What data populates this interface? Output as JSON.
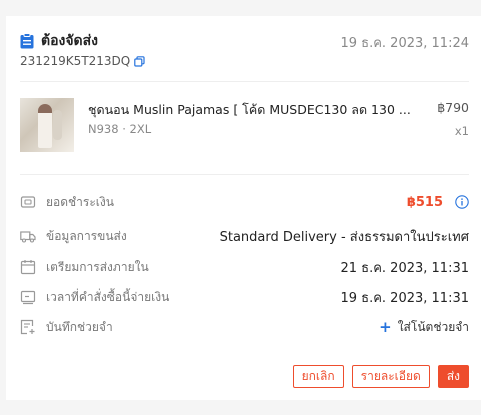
{
  "header": {
    "status": "ต้องจัดส่ง",
    "datetime": "19 ธ.ค. 2023, 11:24",
    "order_id": "231219K5T213DQ"
  },
  "product": {
    "name": "ชุดนอน Muslin Pajamas [ โค้ด MUSDEC130 ลด 130 ...",
    "variant": "N938 · 2XL",
    "price": "฿790",
    "qty": "x1"
  },
  "details": {
    "payment_label": "ยอดชำระเงิน",
    "payment_value": "฿515",
    "shipping_label": "ข้อมูลการขนส่ง",
    "shipping_value": "Standard Delivery - ส่งธรรมดาในประเทศ",
    "prepare_label": "เตรียมการส่งภายใน",
    "prepare_value": "21 ธ.ค. 2023, 11:31",
    "paid_label": "เวลาที่คำสั่งซื้อนี้จ่ายเงิน",
    "paid_value": "19 ธ.ค. 2023, 11:31",
    "note_label": "บันทึกช่วยจำ",
    "note_action": "ใส่โน้ตช่วยจำ"
  },
  "actions": {
    "cancel": "ยกเลิก",
    "details": "รายละเอียด",
    "ship": "ส่ง"
  },
  "colors": {
    "accent": "#ee4d2d",
    "link": "#2673dd"
  },
  "icons": [
    "clipboard-icon",
    "copy-icon",
    "wallet-icon",
    "truck-icon",
    "calendar-icon",
    "clock-icon",
    "note-icon",
    "info-icon",
    "plus-icon"
  ]
}
